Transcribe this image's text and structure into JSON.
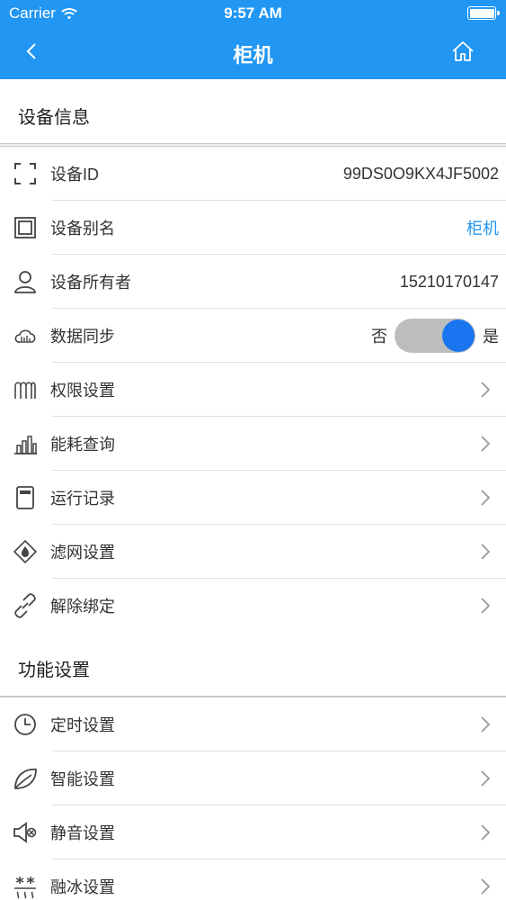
{
  "status_bar": {
    "carrier": "Carrier",
    "time": "9:57 AM"
  },
  "nav": {
    "title": "柜机",
    "back_icon": "chevron-left-icon",
    "home_icon": "home-icon"
  },
  "colors": {
    "accent": "#2196f3",
    "toggle_on": "#1976f0",
    "background": "#efeff4"
  },
  "device_info": {
    "header": "设备信息",
    "rows": [
      {
        "label": "设备ID",
        "value": "99DS0O9KX4JF5002",
        "icon": "scan-frame-icon"
      },
      {
        "label": "设备别名",
        "value": "柜机",
        "icon": "square-frame-icon"
      },
      {
        "label": "设备所有者",
        "value": "15210170147",
        "icon": "user-icon"
      },
      {
        "label": "数据同步",
        "icon": "cloud-sync-icon",
        "toggle": {
          "off_label": "否",
          "on_label": "是",
          "on": true
        }
      },
      {
        "label": "权限设置",
        "icon": "permission-icon"
      },
      {
        "label": "能耗查询",
        "icon": "bar-chart-icon"
      },
      {
        "label": "运行记录",
        "icon": "record-icon"
      },
      {
        "label": "滤网设置",
        "icon": "filter-drop-icon"
      },
      {
        "label": "解除绑定",
        "icon": "unlink-icon"
      }
    ]
  },
  "function_settings": {
    "header": "功能设置",
    "rows": [
      {
        "label": "定时设置",
        "icon": "clock-icon"
      },
      {
        "label": "智能设置",
        "icon": "leaf-icon"
      },
      {
        "label": "静音设置",
        "icon": "speaker-mute-icon"
      },
      {
        "label": "融冰设置",
        "icon": "defrost-icon"
      }
    ]
  }
}
